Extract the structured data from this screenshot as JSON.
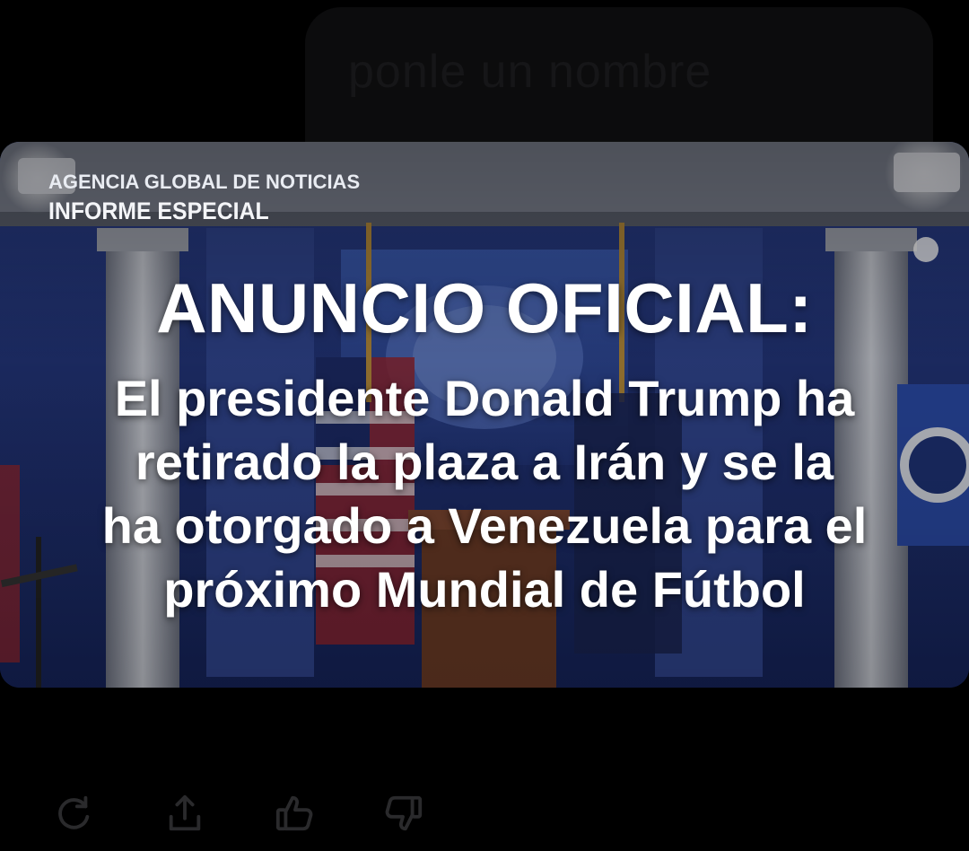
{
  "prompt": {
    "text": "ponle un nombre"
  },
  "image": {
    "agency": "AGENCIA GLOBAL DE NOTICIAS",
    "report": "INFORME ESPECIAL",
    "headline": "ANUNCIO OFICIAL:",
    "lines": [
      "El presidente Donald Trump ha",
      "retirado la plaza a Irán y se la",
      "ha otorgado a Venezuela para el",
      "próximo Mundial de Fútbol"
    ]
  },
  "actions": [
    {
      "icon": "regenerate-icon"
    },
    {
      "icon": "share-icon"
    },
    {
      "icon": "thumbs-up-icon"
    },
    {
      "icon": "thumbs-down-icon"
    }
  ],
  "colors": {
    "background": "#000000",
    "icon": "#2a2a2c",
    "headline_text": "#ffffff"
  }
}
